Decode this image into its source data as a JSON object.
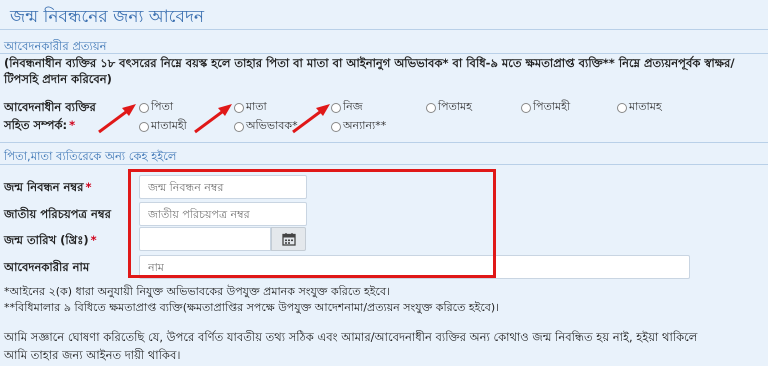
{
  "form": {
    "title": "জন্ম নিবন্ধনের জন্য আবেদন"
  },
  "applicant_section": {
    "heading": "আবেদনকারীর প্রত্যয়ন",
    "instruction": "(নিবন্ধনাধীন ব্যক্তির ১৮ বৎসরের নিম্নে বয়স্ক হলে তাহার পিতা বা মাতা বা আইনানুগ অভিভাবক* বা বিধি-৯ মতে ক্ষমতাপ্রাপ্ত ব্যক্তি** নিম্নে প্রত্যয়নপূর্বক স্বাক্ষর/টিপসহি প্রদান করিবেন)",
    "relation_label_line1": "আবেদনাধীন ব্যক্তির",
    "relation_label_line2": "সহিত সম্পর্ক:",
    "required_mark": "*",
    "relation_options": [
      {
        "label": "পিতা"
      },
      {
        "label": "মাতা"
      },
      {
        "label": "নিজ"
      },
      {
        "label": "পিতামহ"
      },
      {
        "label": "পিতামহী"
      },
      {
        "label": "মাতামহ"
      },
      {
        "label": "মাতামহী"
      },
      {
        "label": "অভিভাবক*"
      },
      {
        "label": "অন্যান্য**"
      }
    ]
  },
  "other_applicant_section": {
    "heading": "পিতা,মাতা ব্যতিরেকে অন্য কেহ হইলে",
    "fields": {
      "birth_reg_no": {
        "label": "জন্ম নিবন্ধন নম্বর",
        "required_mark": "*",
        "placeholder": "জন্ম নিবন্ধন নম্বর",
        "value": ""
      },
      "nid_no": {
        "label": "জাতীয় পরিচয়পত্র নম্বর",
        "placeholder": "জাতীয় পরিচয়পত্র নম্বর",
        "value": ""
      },
      "dob": {
        "label": "জন্ম তারিখ (খ্রিঃ)",
        "required_mark": "*",
        "placeholder": "",
        "value": ""
      },
      "name": {
        "label": "আবেদনকারীর নাম",
        "placeholder": "নাম",
        "value": ""
      }
    },
    "icons": {
      "calendar": "calendar-icon"
    }
  },
  "notes": {
    "note1": "*আইনের ২(ক) ধারা অনুযায়ী নিযুক্ত অভিভাবকের উপযুক্ত প্রমানক সংযুক্ত করিতে হইবে।",
    "note2": "**বিধিমালার ৯ বিধিতে ক্ষমতাপ্রাপ্ত ব্যক্তি(ক্ষমতাপ্রাপ্তির সপক্ষে উপযুক্ত আদেশনামা/প্রত্যয়ন সংযুক্ত করিতে হইবে)।"
  },
  "declaration": {
    "line1": "আমি সজ্ঞানে ঘোষণা করিতেছি যে, উপরে বর্ণিত যাবতীয় তথ্য সঠিক এবং আমার/আবেদনাধীন ব্যক্তির অন্য কোথাও জন্ম নিবন্ধিত হয় নাই, হইয়া থাকিলে",
    "line2": "আমি তাহার জন্য আইনত দায়ী থাকিব।"
  },
  "colors": {
    "page_bg": "#e9f2fb",
    "heading_blue": "#3b74b4",
    "required_red": "#d0021b",
    "highlight_red": "#e01818"
  }
}
